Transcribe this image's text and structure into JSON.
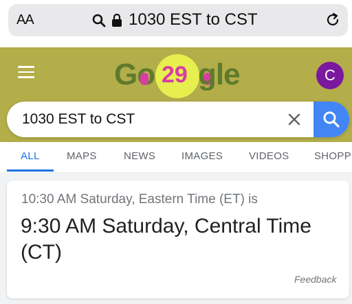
{
  "browser": {
    "text_size_label": "AA",
    "url_text": "1030 EST to CST"
  },
  "google": {
    "doodle_left": "Go",
    "doodle_number": "29",
    "doodle_right": "gle",
    "avatar_initial": "C"
  },
  "search": {
    "value": "1030 EST to CST"
  },
  "tabs": [
    {
      "label": "ALL",
      "active": true
    },
    {
      "label": "MAPS"
    },
    {
      "label": "NEWS"
    },
    {
      "label": "IMAGES"
    },
    {
      "label": "VIDEOS"
    },
    {
      "label": "SHOPPI"
    }
  ],
  "result": {
    "question": "10:30 AM Saturday, Eastern Time (ET) is",
    "answer": "9:30 AM Saturday, Central Time (CT)",
    "feedback_label": "Feedback"
  },
  "colors": {
    "header_bg": "#b3ad4a",
    "search_blue": "#4285f4",
    "tab_active": "#1a73e8",
    "avatar_bg": "#7a189e",
    "doodle_pink": "#d83ea1"
  },
  "icons": [
    "search-icon",
    "lock-icon",
    "reload-icon",
    "menu-icon",
    "clear-icon",
    "search-icon"
  ]
}
